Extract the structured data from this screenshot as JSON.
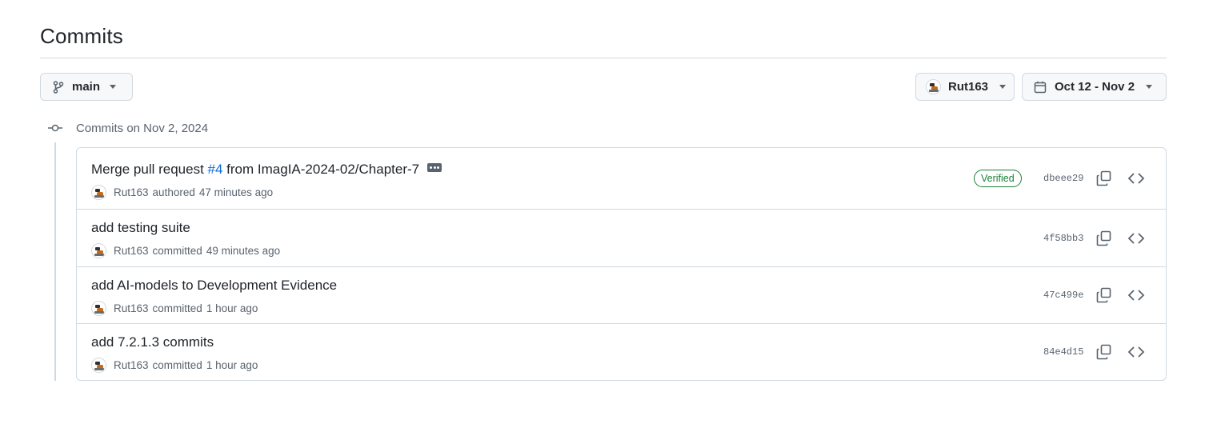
{
  "page": {
    "title": "Commits"
  },
  "filters": {
    "branch": {
      "label": "main",
      "icon": "git-branch-icon"
    },
    "user": {
      "label": "Rut163",
      "icon": "avatar"
    },
    "date": {
      "label": "Oct 12 - Nov 2",
      "icon": "calendar-icon"
    }
  },
  "group": {
    "label": "Commits on Nov 2, 2024",
    "icon": "git-commit-icon"
  },
  "commits": [
    {
      "title_prefix": "Merge pull request ",
      "pr_number": "#4",
      "title_suffix": " from ImagIA-2024-02/Chapter-7",
      "author": "Rut163",
      "action": "authored",
      "time": "47 minutes ago",
      "verified": "Verified",
      "sha": "dbeee29"
    },
    {
      "title": "add testing suite",
      "author": "Rut163",
      "action": "committed",
      "time": "49 minutes ago",
      "sha": "4f58bb3"
    },
    {
      "title": "add AI-models to Development Evidence",
      "author": "Rut163",
      "action": "committed",
      "time": "1 hour ago",
      "sha": "47c499e"
    },
    {
      "title": "add 7.2.1.3 commits",
      "author": "Rut163",
      "action": "committed",
      "time": "1 hour ago",
      "sha": "84e4d15"
    }
  ],
  "colors": {
    "link": "#0969da",
    "verified": "#1a7f37",
    "muted": "#59636e",
    "border": "#d1d9e0"
  }
}
